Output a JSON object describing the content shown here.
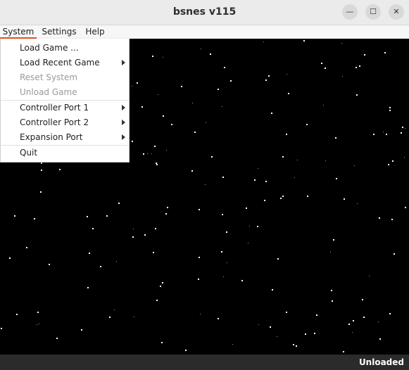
{
  "window": {
    "title": "bsnes v115",
    "minimize_glyph": "—",
    "maximize_glyph": "☐",
    "close_glyph": "✕"
  },
  "menubar": {
    "items": [
      {
        "label": "System"
      },
      {
        "label": "Settings"
      },
      {
        "label": "Help"
      }
    ]
  },
  "system_menu": {
    "items": [
      {
        "label": "Load Game ...",
        "enabled": true,
        "submenu": false
      },
      {
        "label": "Load Recent Game",
        "enabled": true,
        "submenu": true
      },
      {
        "label": "Reset System",
        "enabled": false,
        "submenu": false
      },
      {
        "label": "Unload Game",
        "enabled": false,
        "submenu": false
      },
      {
        "label": "Controller Port 1",
        "enabled": true,
        "submenu": true
      },
      {
        "label": "Controller Port 2",
        "enabled": true,
        "submenu": true
      },
      {
        "label": "Expansion Port",
        "enabled": true,
        "submenu": true
      },
      {
        "label": "Quit",
        "enabled": true,
        "submenu": false
      }
    ]
  },
  "statusbar": {
    "text": "Unloaded"
  },
  "colors": {
    "accent": "#e95420",
    "video_bg": "#000000",
    "statusbar_bg": "#2b2b2b"
  }
}
